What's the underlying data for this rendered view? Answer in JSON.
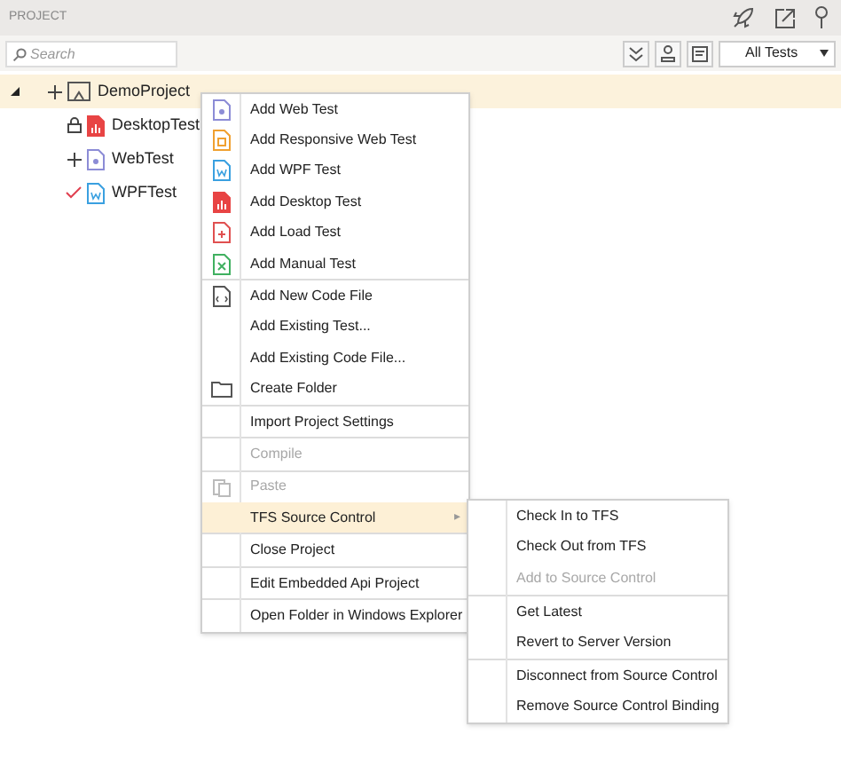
{
  "panel": {
    "title": "PROJECT"
  },
  "toolbar": {
    "search": {
      "placeholder": "Search"
    },
    "filter": {
      "value": "All Tests"
    }
  },
  "tree": {
    "label": "DemoProject",
    "kind": "project",
    "pending_add": true,
    "locked": false,
    "checked_out": false,
    "expanded": true,
    "selected": true,
    "children": [
      {
        "label": "DesktopTest",
        "kind": "desktop",
        "pending_add": false,
        "locked": true,
        "checked_out": false,
        "selected": false
      },
      {
        "label": "WebTest",
        "kind": "web",
        "pending_add": true,
        "locked": false,
        "checked_out": false,
        "selected": false
      },
      {
        "label": "WPFTest",
        "kind": "wpf",
        "pending_add": false,
        "locked": false,
        "checked_out": true,
        "selected": false
      }
    ]
  },
  "context_menu": {
    "groups": [
      [
        {
          "label": "Add Web Test",
          "kind": "web",
          "disabled": false,
          "selected": false
        },
        {
          "label": "Add Responsive Web Test",
          "kind": "responsive",
          "disabled": false,
          "selected": false
        },
        {
          "label": "Add WPF Test",
          "kind": "wpf",
          "disabled": false,
          "selected": false
        },
        {
          "label": "Add Desktop Test",
          "kind": "desktop",
          "disabled": false,
          "selected": false
        },
        {
          "label": "Add Load Test",
          "kind": "load",
          "disabled": false,
          "selected": false
        },
        {
          "label": "Add Manual Test",
          "kind": "manual",
          "disabled": false,
          "selected": false
        }
      ],
      [
        {
          "label": "Add New Code File",
          "kind": "code",
          "disabled": false,
          "selected": false
        },
        {
          "label": "Add Existing Test...",
          "kind": "plain",
          "disabled": false,
          "selected": false
        },
        {
          "label": "Add Existing Code File...",
          "kind": "plain",
          "disabled": false,
          "selected": false
        },
        {
          "label": "Create Folder",
          "kind": "folder",
          "disabled": false,
          "selected": false
        }
      ],
      [
        {
          "label": "Import Project Settings",
          "kind": "plain",
          "disabled": false,
          "selected": false
        }
      ],
      [
        {
          "label": "Compile",
          "kind": "plain",
          "disabled": true,
          "selected": false
        }
      ],
      [
        {
          "label": "Paste",
          "kind": "paste",
          "disabled": true,
          "selected": false
        },
        {
          "label": "TFS Source Control",
          "kind": "plain",
          "disabled": false,
          "selected": true,
          "arrow": "▸"
        }
      ],
      [
        {
          "label": "Close Project",
          "kind": "plain",
          "disabled": false,
          "selected": false
        }
      ],
      [
        {
          "label": "Edit Embedded Api Project",
          "kind": "plain",
          "disabled": false,
          "selected": false
        }
      ],
      [
        {
          "label": "Open Folder in Windows Explorer",
          "kind": "plain",
          "disabled": false,
          "selected": false
        }
      ]
    ]
  },
  "submenu": {
    "groups": [
      [
        {
          "label": "Check In to TFS",
          "disabled": false
        },
        {
          "label": "Check Out from TFS",
          "disabled": false
        },
        {
          "label": "Add to Source Control",
          "disabled": true
        }
      ],
      [
        {
          "label": "Get Latest",
          "disabled": false
        },
        {
          "label": "Revert to Server Version",
          "disabled": false
        }
      ],
      [
        {
          "label": "Disconnect from Source Control",
          "disabled": false
        },
        {
          "label": "Remove Source Control Binding",
          "disabled": false
        }
      ]
    ]
  }
}
